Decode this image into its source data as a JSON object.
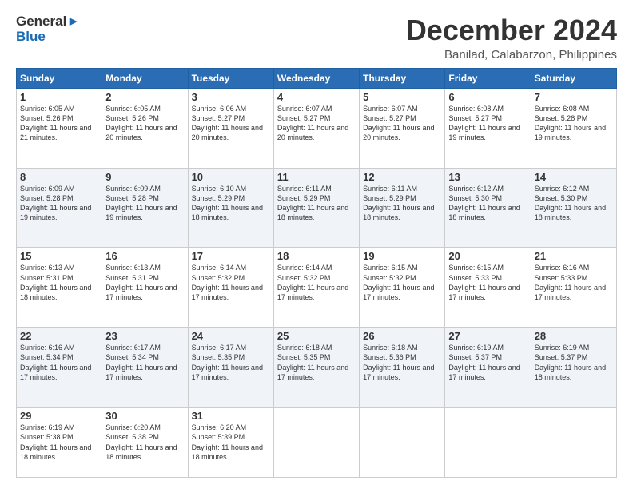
{
  "app": {
    "logo_line1": "General",
    "logo_line2": "Blue"
  },
  "header": {
    "month_title": "December 2024",
    "location": "Banilad, Calabarzon, Philippines"
  },
  "days_of_week": [
    "Sunday",
    "Monday",
    "Tuesday",
    "Wednesday",
    "Thursday",
    "Friday",
    "Saturday"
  ],
  "weeks": [
    [
      {
        "day": "1",
        "sunrise": "6:05 AM",
        "sunset": "5:26 PM",
        "daylight": "11 hours and 21 minutes."
      },
      {
        "day": "2",
        "sunrise": "6:05 AM",
        "sunset": "5:26 PM",
        "daylight": "11 hours and 20 minutes."
      },
      {
        "day": "3",
        "sunrise": "6:06 AM",
        "sunset": "5:27 PM",
        "daylight": "11 hours and 20 minutes."
      },
      {
        "day": "4",
        "sunrise": "6:07 AM",
        "sunset": "5:27 PM",
        "daylight": "11 hours and 20 minutes."
      },
      {
        "day": "5",
        "sunrise": "6:07 AM",
        "sunset": "5:27 PM",
        "daylight": "11 hours and 20 minutes."
      },
      {
        "day": "6",
        "sunrise": "6:08 AM",
        "sunset": "5:27 PM",
        "daylight": "11 hours and 19 minutes."
      },
      {
        "day": "7",
        "sunrise": "6:08 AM",
        "sunset": "5:28 PM",
        "daylight": "11 hours and 19 minutes."
      }
    ],
    [
      {
        "day": "8",
        "sunrise": "6:09 AM",
        "sunset": "5:28 PM",
        "daylight": "11 hours and 19 minutes."
      },
      {
        "day": "9",
        "sunrise": "6:09 AM",
        "sunset": "5:28 PM",
        "daylight": "11 hours and 19 minutes."
      },
      {
        "day": "10",
        "sunrise": "6:10 AM",
        "sunset": "5:29 PM",
        "daylight": "11 hours and 18 minutes."
      },
      {
        "day": "11",
        "sunrise": "6:11 AM",
        "sunset": "5:29 PM",
        "daylight": "11 hours and 18 minutes."
      },
      {
        "day": "12",
        "sunrise": "6:11 AM",
        "sunset": "5:29 PM",
        "daylight": "11 hours and 18 minutes."
      },
      {
        "day": "13",
        "sunrise": "6:12 AM",
        "sunset": "5:30 PM",
        "daylight": "11 hours and 18 minutes."
      },
      {
        "day": "14",
        "sunrise": "6:12 AM",
        "sunset": "5:30 PM",
        "daylight": "11 hours and 18 minutes."
      }
    ],
    [
      {
        "day": "15",
        "sunrise": "6:13 AM",
        "sunset": "5:31 PM",
        "daylight": "11 hours and 18 minutes."
      },
      {
        "day": "16",
        "sunrise": "6:13 AM",
        "sunset": "5:31 PM",
        "daylight": "11 hours and 17 minutes."
      },
      {
        "day": "17",
        "sunrise": "6:14 AM",
        "sunset": "5:32 PM",
        "daylight": "11 hours and 17 minutes."
      },
      {
        "day": "18",
        "sunrise": "6:14 AM",
        "sunset": "5:32 PM",
        "daylight": "11 hours and 17 minutes."
      },
      {
        "day": "19",
        "sunrise": "6:15 AM",
        "sunset": "5:32 PM",
        "daylight": "11 hours and 17 minutes."
      },
      {
        "day": "20",
        "sunrise": "6:15 AM",
        "sunset": "5:33 PM",
        "daylight": "11 hours and 17 minutes."
      },
      {
        "day": "21",
        "sunrise": "6:16 AM",
        "sunset": "5:33 PM",
        "daylight": "11 hours and 17 minutes."
      }
    ],
    [
      {
        "day": "22",
        "sunrise": "6:16 AM",
        "sunset": "5:34 PM",
        "daylight": "11 hours and 17 minutes."
      },
      {
        "day": "23",
        "sunrise": "6:17 AM",
        "sunset": "5:34 PM",
        "daylight": "11 hours and 17 minutes."
      },
      {
        "day": "24",
        "sunrise": "6:17 AM",
        "sunset": "5:35 PM",
        "daylight": "11 hours and 17 minutes."
      },
      {
        "day": "25",
        "sunrise": "6:18 AM",
        "sunset": "5:35 PM",
        "daylight": "11 hours and 17 minutes."
      },
      {
        "day": "26",
        "sunrise": "6:18 AM",
        "sunset": "5:36 PM",
        "daylight": "11 hours and 17 minutes."
      },
      {
        "day": "27",
        "sunrise": "6:19 AM",
        "sunset": "5:37 PM",
        "daylight": "11 hours and 17 minutes."
      },
      {
        "day": "28",
        "sunrise": "6:19 AM",
        "sunset": "5:37 PM",
        "daylight": "11 hours and 18 minutes."
      }
    ],
    [
      {
        "day": "29",
        "sunrise": "6:19 AM",
        "sunset": "5:38 PM",
        "daylight": "11 hours and 18 minutes."
      },
      {
        "day": "30",
        "sunrise": "6:20 AM",
        "sunset": "5:38 PM",
        "daylight": "11 hours and 18 minutes."
      },
      {
        "day": "31",
        "sunrise": "6:20 AM",
        "sunset": "5:39 PM",
        "daylight": "11 hours and 18 minutes."
      },
      null,
      null,
      null,
      null
    ]
  ]
}
